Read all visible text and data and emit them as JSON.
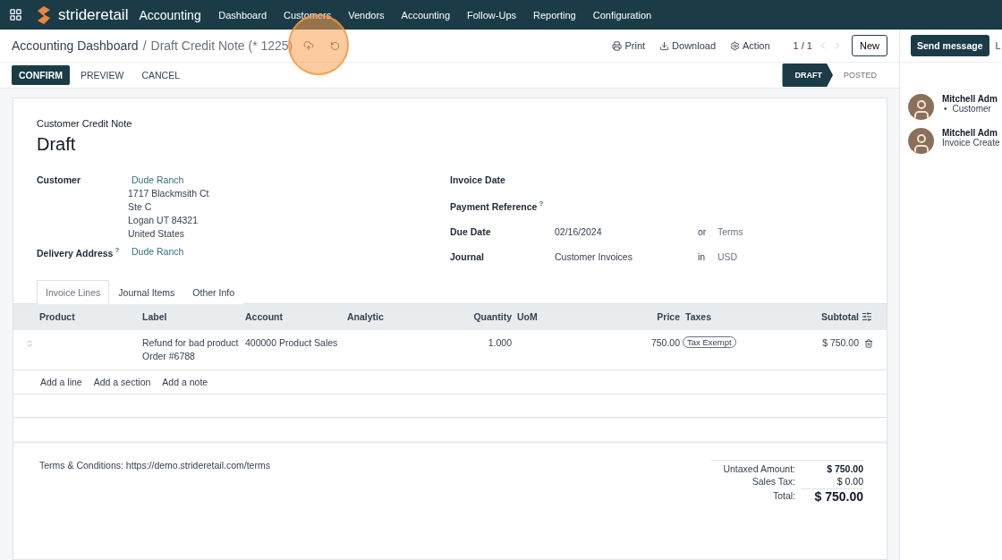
{
  "navbar": {
    "logo": "strideretail",
    "app": "Accounting",
    "menu": [
      "Dashboard",
      "Customers",
      "Vendors",
      "Accounting",
      "Follow-Ups",
      "Reporting",
      "Configuration"
    ]
  },
  "breadcrumb": {
    "parent": "Accounting Dashboard",
    "separator": "/",
    "current": "Draft Credit Note (* 1225)"
  },
  "actions": [
    "Print",
    "Download",
    "Action"
  ],
  "pager": "1 / 1",
  "new_button": "New",
  "buttons": [
    {
      "label": "CONFIRM",
      "primary": true
    },
    {
      "label": "PREVIEW",
      "primary": false
    },
    {
      "label": "CANCEL",
      "primary": false
    }
  ],
  "statusbar": [
    {
      "label": "DRAFT",
      "selected": true
    },
    {
      "label": "POSTED",
      "selected": false
    }
  ],
  "chatter": {
    "send": "Send message",
    "cut_button": "L",
    "messages": [
      {
        "author": "Mitchell Adm",
        "text": "Customer",
        "bullet": "•"
      },
      {
        "author": "Mitchell Adm",
        "text": "Invoice Create"
      }
    ]
  },
  "sheet": {
    "subtitle": "Customer Credit Note",
    "title": "Draft",
    "left_fields": [
      {
        "label": "Customer",
        "value": "Dude Ranch",
        "address": [
          "1717 Blackmsith Ct",
          "Ste C",
          "Logan UT 84321",
          "United States"
        ]
      },
      {
        "label": "Delivery Address",
        "help": "?",
        "value": "Dude Ranch"
      }
    ],
    "right_fields": [
      {
        "label": "Invoice Date"
      },
      {
        "label": "Payment Reference",
        "help": "?"
      },
      {
        "label": "Due Date",
        "value": "02/16/2024",
        "joiner": "or",
        "extra": "Terms"
      },
      {
        "label": "Journal",
        "value": "Customer Invoices",
        "joiner": "in",
        "extra": "USD"
      }
    ],
    "tabs": [
      {
        "label": "Invoice Lines",
        "selected": true
      },
      {
        "label": "Journal Items",
        "selected": false
      },
      {
        "label": "Other Info",
        "selected": false
      }
    ],
    "table": {
      "columns": [
        "Product",
        "Label",
        "Account",
        "Analytic",
        "Quantity",
        "UoM",
        "Price",
        "Taxes",
        "Subtotal"
      ],
      "rows": [
        {
          "product": "",
          "label": "Refund for bad product Order #6788",
          "account": "400000 Product Sales",
          "analytic": "",
          "quantity": "1.000",
          "uom": "",
          "price": "750.00",
          "tax": "Tax Exempt",
          "subtotal": "$ 750.00"
        }
      ],
      "add_links": [
        "Add a line",
        "Add a section",
        "Add a note"
      ]
    },
    "terms": "Terms & Conditions: https://demo.strideretail.com/terms",
    "totals": [
      {
        "label": "Untaxed Amount:",
        "value": "$ 750.00",
        "kind": "bold"
      },
      {
        "label": "Sales Tax:",
        "value": "$ 0.00",
        "kind": "plain"
      },
      {
        "label": "Total:",
        "value": "$ 750.00",
        "kind": "grand"
      }
    ]
  }
}
